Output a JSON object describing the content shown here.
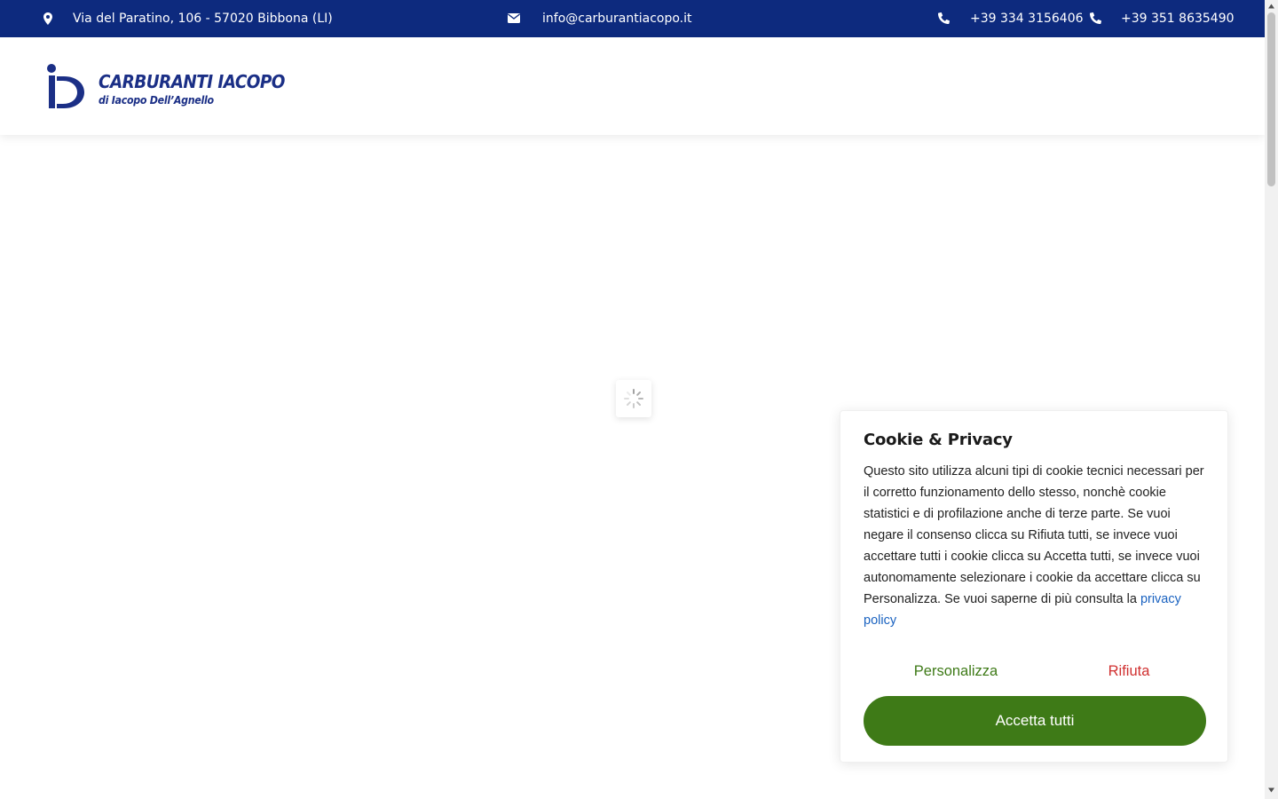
{
  "topbar": {
    "address": "Via del Paratino, 106 - 57020 Bibbona (LI)",
    "email": "info@carburantiacopo.it",
    "phone1": "+39 334 3156406",
    "phone2": "+39 351 8635490",
    "icons": [
      "map-marker-icon",
      "envelope-icon",
      "phone-icon",
      "phone-icon"
    ],
    "background_color": "#0d2a7e"
  },
  "header": {
    "logo_name": "CARBURANTI IACOPO",
    "logo_sub": "di Iacopo Dell’Agnello",
    "brand_color": "#1b2f86"
  },
  "cookie": {
    "title": "Cookie & Privacy",
    "body": "Questo sito utilizza alcuni tipi di cookie tecnici necessari per il corretto funzionamento dello stesso, nonchè cookie statistici e di profilazione anche di terze parte. Se vuoi negare il consenso clicca su Rifiuta tutti, se invece vuoi accettare tutti i cookie clicca su Accetta tutti, se invece vuoi autonomamente selezionare i cookie da accettare clicca su Personalizza. Se vuoi saperne di più consulta la",
    "privacy_link": "privacy policy",
    "personalizza_label": "Personalizza",
    "rifiuta_label": "Rifiuta",
    "accept_label": "Accetta tutti",
    "accent_color": "#3e7a17",
    "reject_color": "#d03030"
  }
}
